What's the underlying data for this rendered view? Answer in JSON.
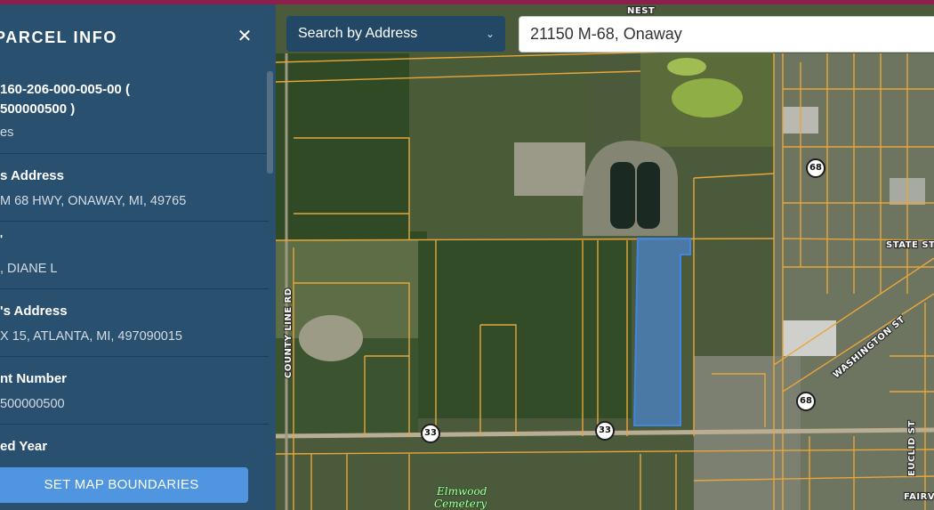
{
  "search": {
    "mode_label": "Search by Address",
    "value": "21150 M-68, Onaway"
  },
  "panel": {
    "title": "PARCEL INFO",
    "close_icon": "close-icon",
    "fields": [
      {
        "label": "",
        "value_lines": [
          "160-206-000-005-00  (",
          "500000500 )"
        ],
        "extra": "es"
      },
      {
        "label": "s Address",
        "value": "M 68 HWY, ONAWAY, MI, 49765"
      },
      {
        "label": "",
        "value": ", DIANE L"
      },
      {
        "label": "'s Address",
        "value": "X 15, ATLANTA, MI, 497090015"
      },
      {
        "label": "nt Number",
        "value": "500000500"
      },
      {
        "label": "ed Year",
        "value": ""
      }
    ],
    "set_bounds_label": "SET MAP BOUNDARIES"
  },
  "map": {
    "labels": {
      "nest": "NEST",
      "state_st": "STATE ST",
      "washington_st": "WASHINGTON ST",
      "county_line_rd": "COUNTY LINE RD",
      "euclid_st": "EUCLID ST",
      "fairv": "FAIRV",
      "elmwood": "Elmwood",
      "cemetery": "Cemetery"
    },
    "shields": [
      "33",
      "33",
      "68",
      "68"
    ],
    "colors": {
      "parcel_lines": "#e8a63a",
      "selected_parcel": "#4a8de6",
      "panel_bg": "#2a5070",
      "top_bar": "#8e1e4b"
    }
  }
}
